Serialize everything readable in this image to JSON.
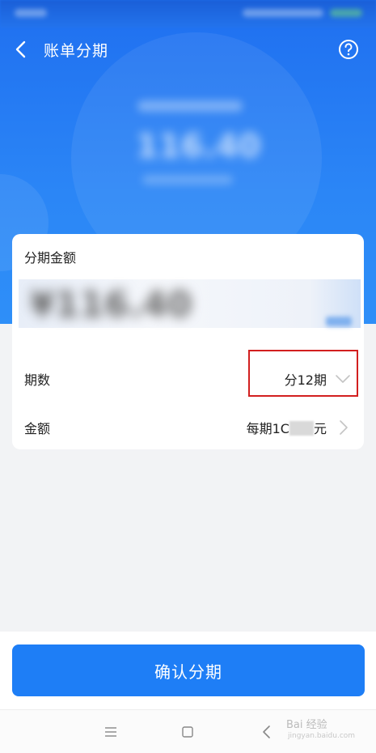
{
  "navbar": {
    "title": "账单分期",
    "back_icon": "chevron-left-icon",
    "help_icon": "question-circle-icon"
  },
  "card": {
    "label": "分期金额",
    "periods": {
      "label": "期数",
      "value": "分12期",
      "icon": "chevron-down-icon"
    },
    "amount": {
      "label": "金额",
      "value_prefix": "每期1C",
      "value_suffix": "元",
      "icon": "chevron-right-icon"
    }
  },
  "confirm_button": {
    "label": "确认分期"
  },
  "system_nav": {
    "menu_icon": "menu-icon",
    "home_icon": "square-icon",
    "back_icon": "triangle-back-icon"
  },
  "watermark": {
    "text": "Bai 经验",
    "sub": "jingyan.baidu.com"
  },
  "colors": {
    "primary": "#1e7ef6",
    "hero_top": "#1f6ff0",
    "highlight_box": "#d21f1f",
    "background": "#f2f3f5"
  }
}
